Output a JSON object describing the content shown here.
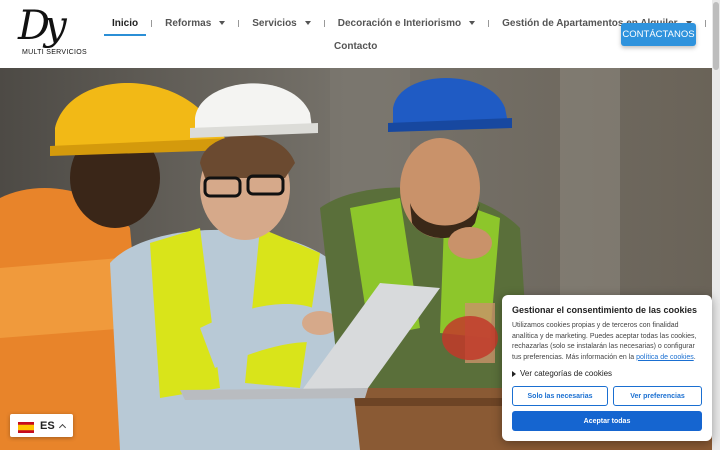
{
  "logo": {
    "mark": "Dy",
    "text": "MULTI SERVICIOS"
  },
  "nav": {
    "items": [
      {
        "label": "Inicio",
        "active": true,
        "dropdown": false
      },
      {
        "label": "Reformas",
        "active": false,
        "dropdown": true
      },
      {
        "label": "Servicios",
        "active": false,
        "dropdown": true
      },
      {
        "label": "Decoración e Interiorismo",
        "active": false,
        "dropdown": true
      },
      {
        "label": "Gestión de Apartamentos en Alquiler",
        "active": false,
        "dropdown": true
      },
      {
        "label": "Contacto",
        "active": false,
        "dropdown": false
      }
    ]
  },
  "header": {
    "contact_button": "CONTÁCTANOS"
  },
  "hero": {
    "image": "construction-workers-with-laptop"
  },
  "cookie": {
    "title": "Gestionar el consentimiento de las cookies",
    "body": "Utilizamos cookies propias y de terceros con finalidad analítica y de marketing. Puedes aceptar todas las cookies, rechazarlas (solo se instalarán las necesarias) o configurar tus preferencias. Más información en la",
    "link": "política de cookies",
    "body_end": ".",
    "categories_label": "Ver categorías de cookies",
    "btn_necessary": "Solo las necesarias",
    "btn_preferences": "Ver preferencias",
    "btn_accept": "Aceptar todas"
  },
  "language": {
    "code": "ES",
    "flag": "spain-flag-icon"
  },
  "colors": {
    "accent": "#2f93dd",
    "cookie_primary": "#1565d0"
  }
}
